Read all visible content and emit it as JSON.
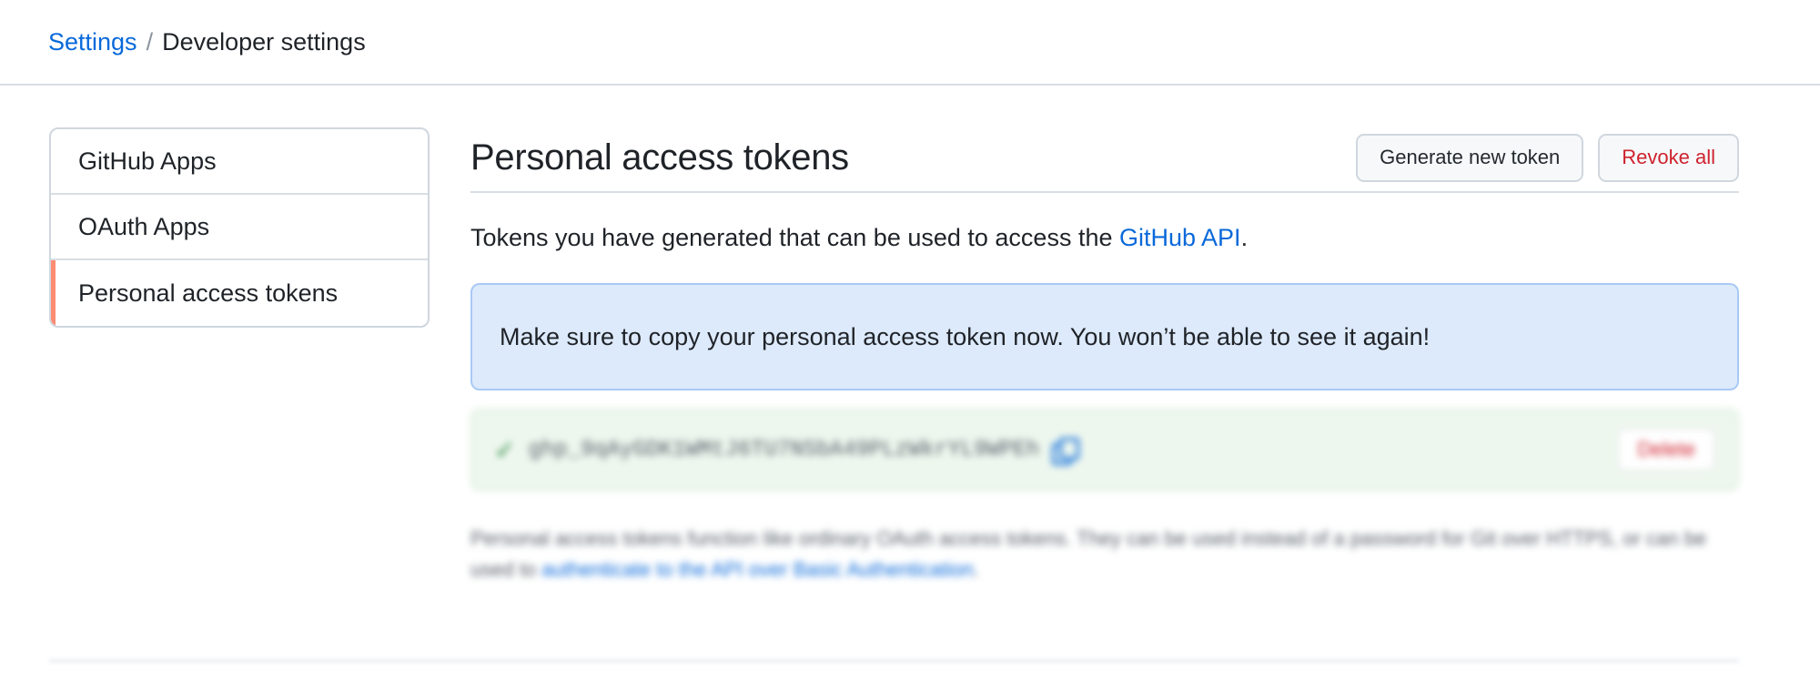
{
  "breadcrumb": {
    "root": "Settings",
    "separator": "/",
    "current": "Developer settings"
  },
  "sidebar": {
    "items": [
      {
        "label": "GitHub Apps"
      },
      {
        "label": "OAuth Apps"
      },
      {
        "label": "Personal access tokens",
        "active": true
      }
    ]
  },
  "main": {
    "title": "Personal access tokens",
    "generate_button": "Generate new token",
    "revoke_button": "Revoke all",
    "intro_text": "Tokens you have generated that can be used to access the ",
    "intro_link": "GitHub API",
    "intro_end": ".",
    "flash_message": "Make sure to copy your personal access token now. You won’t be able to see it again!",
    "token": {
      "value": "ghp_9qAyGDK1WMtJ6TU7NSbA49PLzWkrYL9WPEh",
      "delete_label": "Delete"
    },
    "note_text": "Personal access tokens function like ordinary OAuth access tokens. They can be used instead of a password for Git over HTTPS, or can be used to ",
    "note_link": "authenticate to the API over Basic Authentication",
    "note_end": "."
  },
  "colors": {
    "link": "#0969da",
    "danger": "#cf222e",
    "active_marker": "#fd8c73",
    "flash_bg": "#ddeafb",
    "success_bg": "#eef7ee"
  }
}
